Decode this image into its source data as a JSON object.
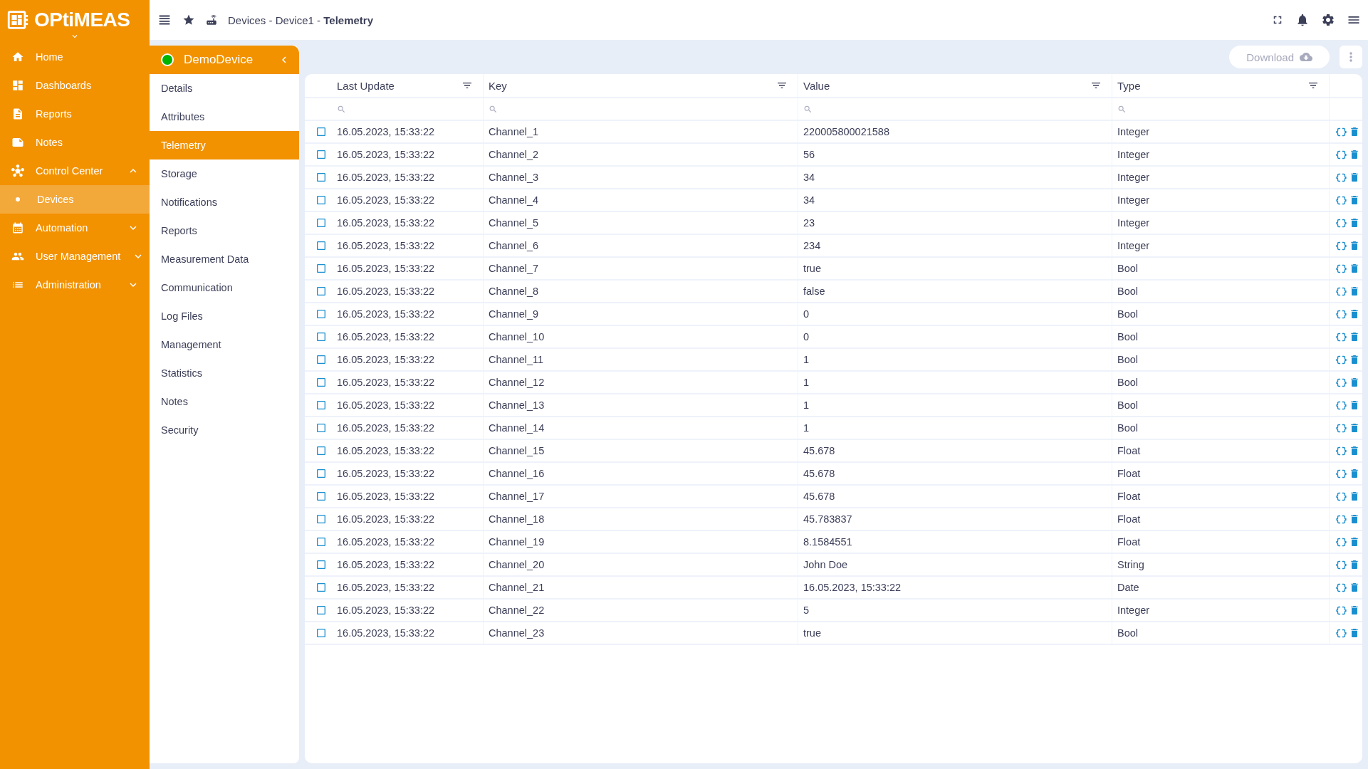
{
  "logo": "OPtiMEAS",
  "nav": [
    {
      "label": "Home"
    },
    {
      "label": "Dashboards"
    },
    {
      "label": "Reports"
    },
    {
      "label": "Notes"
    },
    {
      "label": "Control Center",
      "expanded": true,
      "children": [
        {
          "label": "Devices",
          "selected": true
        }
      ]
    },
    {
      "label": "Automation",
      "expanded": false
    },
    {
      "label": "User Management",
      "expanded": false
    },
    {
      "label": "Administration",
      "expanded": false
    }
  ],
  "breadcrumb": {
    "parts": [
      "Devices",
      "Device1",
      "Telemetry"
    ],
    "separator": "-"
  },
  "device": {
    "name": "DemoDevice",
    "online": true
  },
  "device_menu": [
    {
      "label": "Details",
      "selected": false
    },
    {
      "label": "Attributes",
      "selected": false
    },
    {
      "label": "Telemetry",
      "selected": true
    },
    {
      "label": "Storage",
      "selected": false
    },
    {
      "label": "Notifications",
      "selected": false
    },
    {
      "label": "Reports",
      "selected": false
    },
    {
      "label": "Measurement Data",
      "selected": false
    },
    {
      "label": "Communication",
      "selected": false
    },
    {
      "label": "Log Files",
      "selected": false
    },
    {
      "label": "Management",
      "selected": false
    },
    {
      "label": "Statistics",
      "selected": false
    },
    {
      "label": "Notes",
      "selected": false
    },
    {
      "label": "Security",
      "selected": false
    }
  ],
  "download_button": "Download",
  "table": {
    "columns": [
      "Last Update",
      "Key",
      "Value",
      "Type"
    ],
    "rows": [
      {
        "last_update": "16.05.2023, 15:33:22",
        "key": "Channel_1",
        "value": "220005800021588",
        "type": "Integer",
        "selected": false
      },
      {
        "last_update": "16.05.2023, 15:33:22",
        "key": "Channel_2",
        "value": "56",
        "type": "Integer",
        "selected": false
      },
      {
        "last_update": "16.05.2023, 15:33:22",
        "key": "Channel_3",
        "value": "34",
        "type": "Integer",
        "selected": false
      },
      {
        "last_update": "16.05.2023, 15:33:22",
        "key": "Channel_4",
        "value": "34",
        "type": "Integer",
        "selected": false
      },
      {
        "last_update": "16.05.2023, 15:33:22",
        "key": "Channel_5",
        "value": "23",
        "type": "Integer",
        "selected": false
      },
      {
        "last_update": "16.05.2023, 15:33:22",
        "key": "Channel_6",
        "value": "234",
        "type": "Integer",
        "selected": false
      },
      {
        "last_update": "16.05.2023, 15:33:22",
        "key": "Channel_7",
        "value": "true",
        "type": "Bool",
        "selected": false
      },
      {
        "last_update": "16.05.2023, 15:33:22",
        "key": "Channel_8",
        "value": "false",
        "type": "Bool",
        "selected": false
      },
      {
        "last_update": "16.05.2023, 15:33:22",
        "key": "Channel_9",
        "value": "0",
        "type": "Bool",
        "selected": false
      },
      {
        "last_update": "16.05.2023, 15:33:22",
        "key": "Channel_10",
        "value": "0",
        "type": "Bool",
        "selected": false
      },
      {
        "last_update": "16.05.2023, 15:33:22",
        "key": "Channel_11",
        "value": "1",
        "type": "Bool",
        "selected": false
      },
      {
        "last_update": "16.05.2023, 15:33:22",
        "key": "Channel_12",
        "value": "1",
        "type": "Bool",
        "selected": false
      },
      {
        "last_update": "16.05.2023, 15:33:22",
        "key": "Channel_13",
        "value": "1",
        "type": "Bool",
        "selected": false
      },
      {
        "last_update": "16.05.2023, 15:33:22",
        "key": "Channel_14",
        "value": "1",
        "type": "Bool",
        "selected": false
      },
      {
        "last_update": "16.05.2023, 15:33:22",
        "key": "Channel_15",
        "value": "45.678",
        "type": "Float",
        "selected": false
      },
      {
        "last_update": "16.05.2023, 15:33:22",
        "key": "Channel_16",
        "value": "45.678",
        "type": "Float",
        "selected": false
      },
      {
        "last_update": "16.05.2023, 15:33:22",
        "key": "Channel_17",
        "value": "45.678",
        "type": "Float",
        "selected": false
      },
      {
        "last_update": "16.05.2023, 15:33:22",
        "key": "Channel_18",
        "value": "45.783837",
        "type": "Float",
        "selected": false
      },
      {
        "last_update": "16.05.2023, 15:33:22",
        "key": "Channel_19",
        "value": "8.1584551",
        "type": "Float",
        "selected": false
      },
      {
        "last_update": "16.05.2023, 15:33:22",
        "key": "Channel_20",
        "value": "John Doe",
        "type": "String",
        "selected": false
      },
      {
        "last_update": "16.05.2023, 15:33:22",
        "key": "Channel_21",
        "value": "16.05.2023, 15:33:22",
        "type": "Date",
        "selected": false
      },
      {
        "last_update": "16.05.2023, 15:33:22",
        "key": "Channel_22",
        "value": "5",
        "type": "Integer",
        "selected": false
      },
      {
        "last_update": "16.05.2023, 15:33:22",
        "key": "Channel_23",
        "value": "true",
        "type": "Bool",
        "selected": false
      }
    ]
  }
}
